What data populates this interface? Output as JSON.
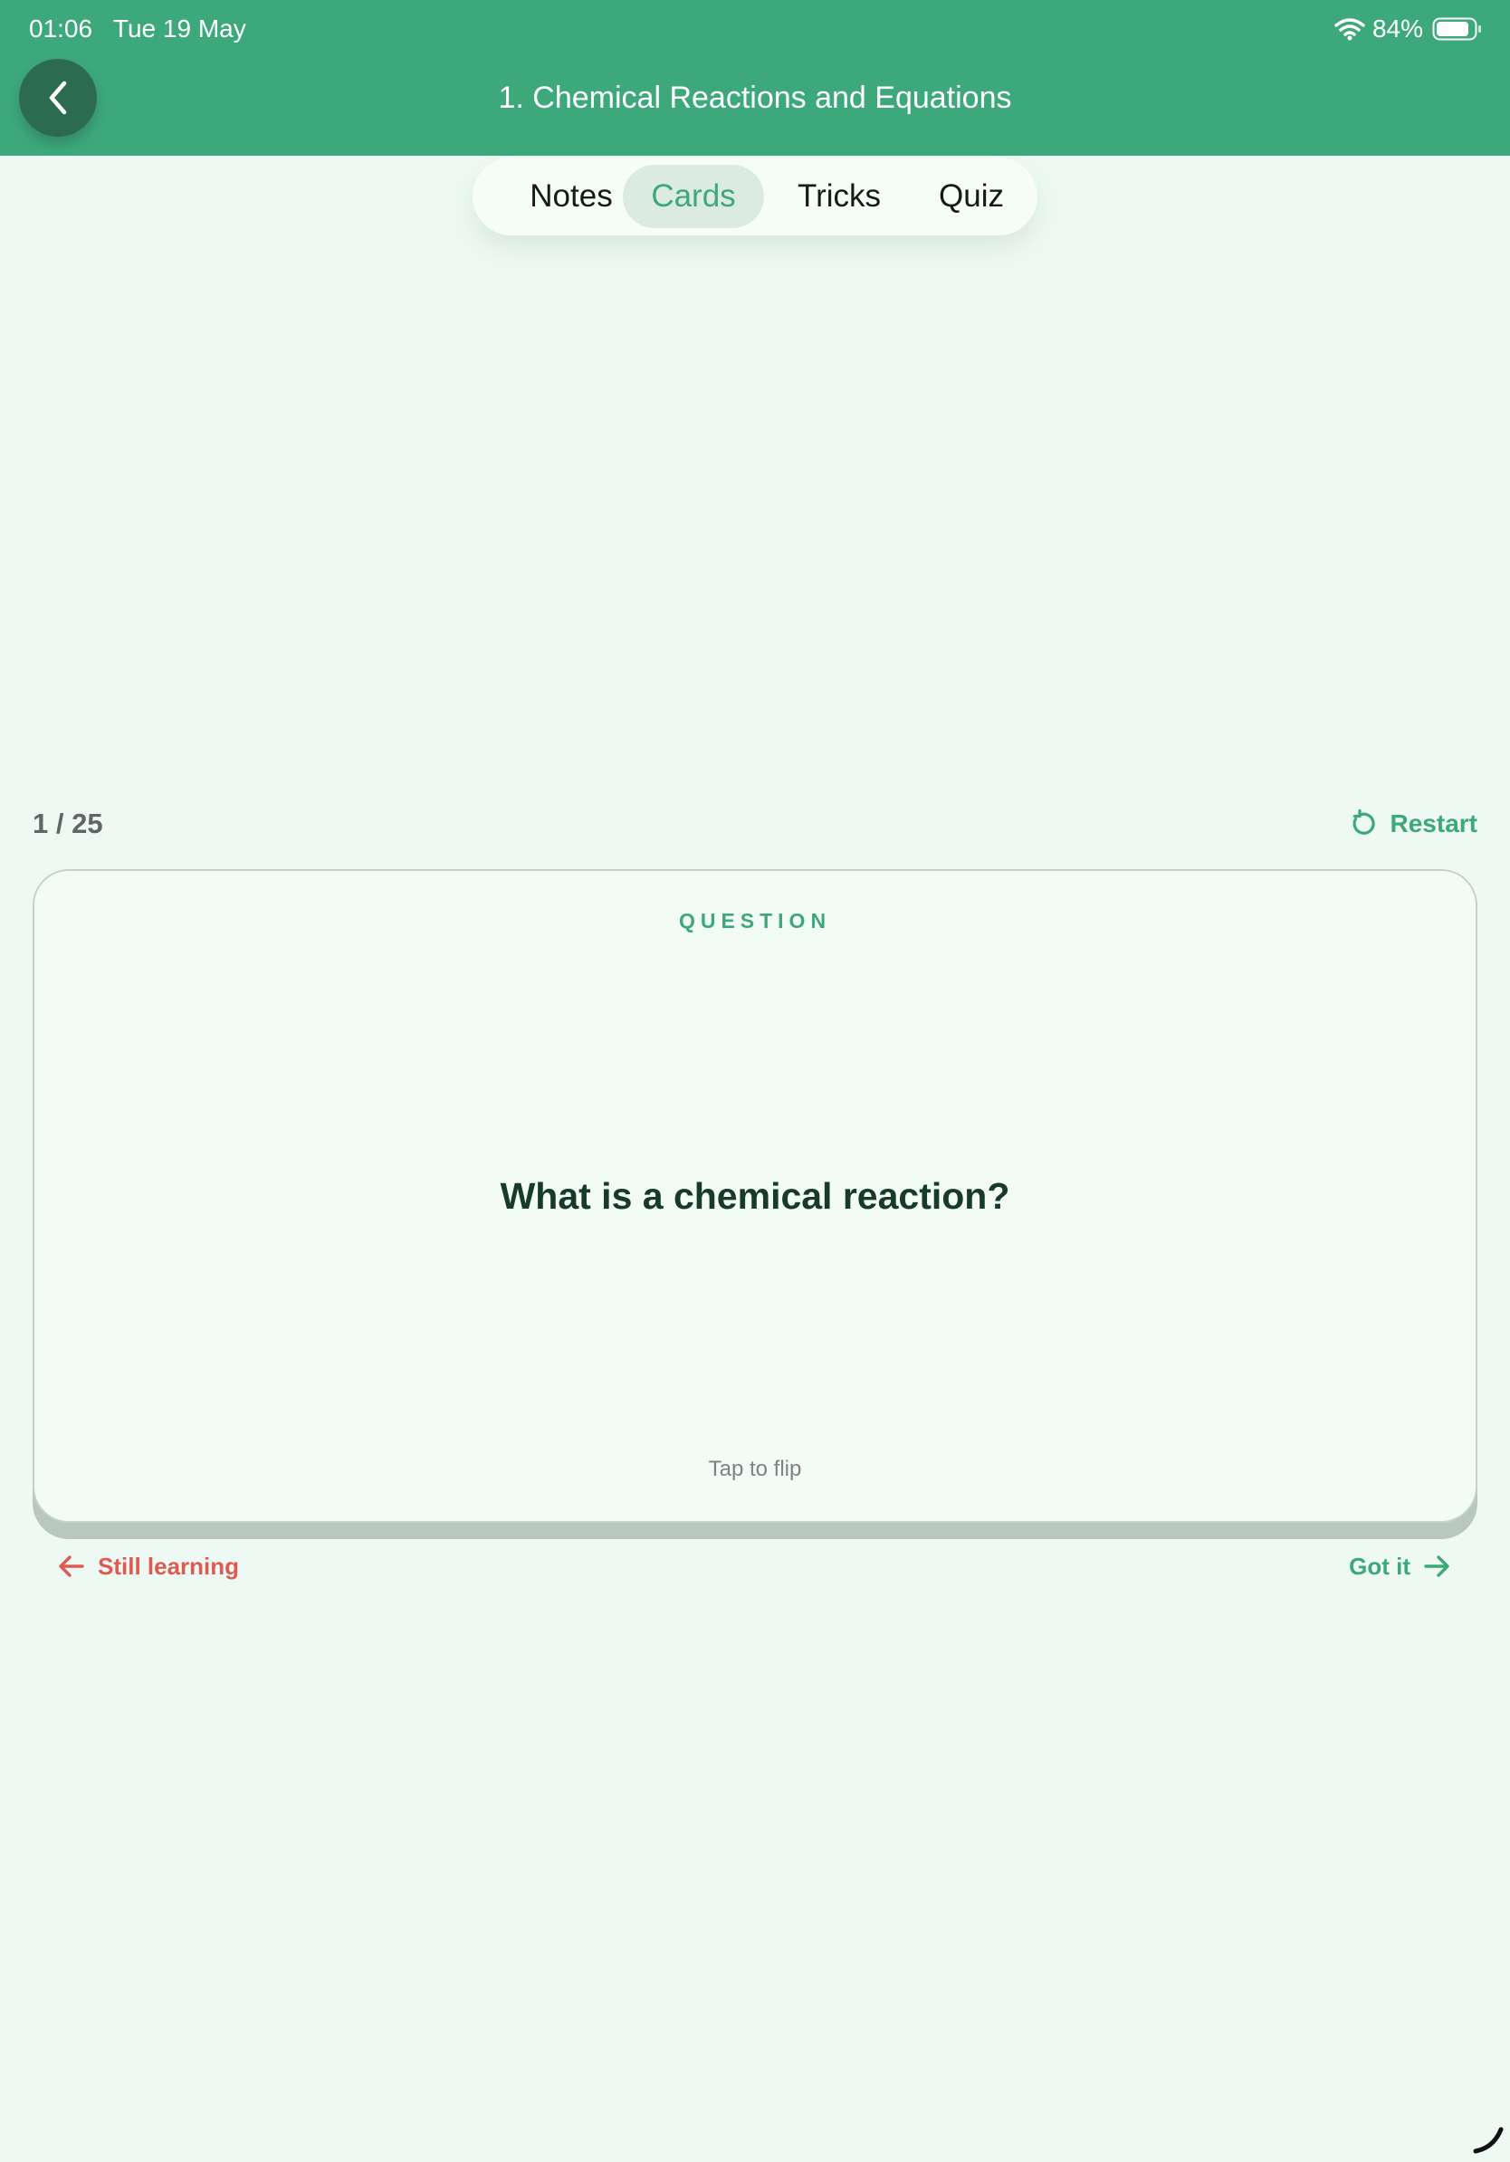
{
  "status_bar": {
    "time": "01:06",
    "date": "Tue 19 May",
    "battery": "84%"
  },
  "header": {
    "title": "1. Chemical Reactions and Equations",
    "back_icon": "chevron-left-icon"
  },
  "tabs": [
    {
      "label": "Notes",
      "active": false
    },
    {
      "label": "Cards",
      "active": true
    },
    {
      "label": "Tricks",
      "active": false
    },
    {
      "label": "Quiz",
      "active": false
    }
  ],
  "progress": {
    "counter": "1 / 25",
    "restart_label": "Restart"
  },
  "card": {
    "side_label": "QUESTION",
    "question": "What is a chemical reaction?",
    "hint": "Tap to flip"
  },
  "actions": {
    "still_learning": "Still learning",
    "got_it": "Got it"
  },
  "colors": {
    "brand": "#3da97b",
    "background": "#eef9f3",
    "negative": "#df5b52"
  }
}
